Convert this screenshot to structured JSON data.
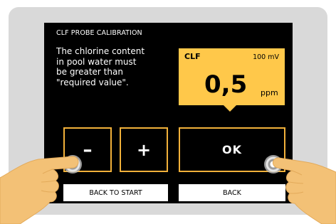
{
  "screen": {
    "title": "CLF PROBE CALIBRATION",
    "message": "The chlorine content\nin pool water must\nbe greater than\n\"required value\"."
  },
  "value_box": {
    "label": "CLF",
    "millivolts": "100 mV",
    "value": "0,5",
    "unit": "ppm"
  },
  "buttons": {
    "minus": "–",
    "plus": "+",
    "ok": "OK"
  },
  "softkeys": {
    "back_to_start": "BACK TO START",
    "back": "BACK"
  },
  "icons": {
    "left_hand": "pointing-hand-icon",
    "right_hand": "pointing-hand-icon"
  },
  "colors": {
    "accent": "#f2b13a",
    "value_box": "#ffc84a",
    "screen_bg": "#000000",
    "hand": "#f3c176"
  }
}
